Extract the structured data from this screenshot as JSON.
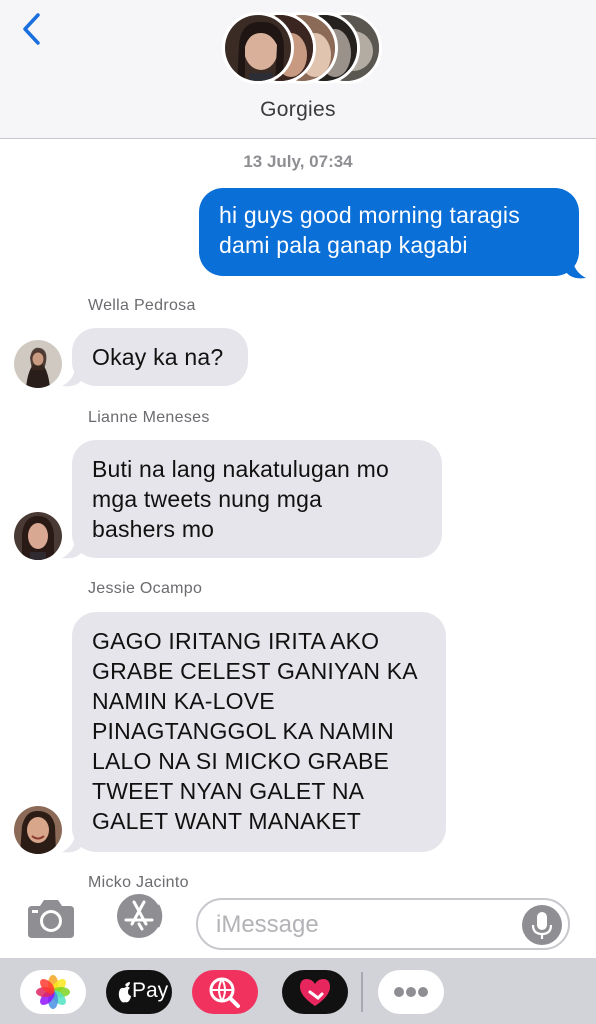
{
  "header": {
    "group_name": "Gorgies"
  },
  "conversation": {
    "timestamp": "13 July, 07:34",
    "messages": [
      {
        "sender": "",
        "direction": "outgoing",
        "text": [
          "hi guys good morning taragis",
          "dami pala ganap kagabi"
        ]
      },
      {
        "sender": "Wella Pedrosa",
        "direction": "incoming",
        "text": [
          "Okay ka na?"
        ]
      },
      {
        "sender": "Lianne Meneses",
        "direction": "incoming",
        "text": [
          "Buti na lang nakatulugan mo",
          "mga tweets nung mga",
          "bashers mo"
        ]
      },
      {
        "sender": "Jessie Ocampo",
        "direction": "incoming",
        "text": [
          "GAGO IRITANG IRITA AKO",
          "GRABE CELEST GANIYAN KA",
          "NAMIN KA-LOVE",
          "PINAGTANGGOL KA NAMIN",
          "LALO NA SI MICKO GRABE",
          "TWEET NYAN GALET NA",
          "GALET WANT MANAKET"
        ]
      },
      {
        "sender": "Micko Jacinto",
        "direction": "incoming",
        "text": []
      }
    ]
  },
  "composer": {
    "placeholder": "iMessage"
  },
  "app_drawer": {
    "apps": [
      {
        "icon": "photos-icon"
      },
      {
        "icon": "apple-pay-icon",
        "label": "Pay"
      },
      {
        "icon": "web-search-icon"
      },
      {
        "icon": "digital-touch-icon"
      },
      {
        "icon": "more-icon"
      }
    ]
  },
  "colors": {
    "outgoing_bubble": "#0b6fd8",
    "incoming_bubble": "#e6e5eb",
    "accent": "#1a6fde"
  }
}
